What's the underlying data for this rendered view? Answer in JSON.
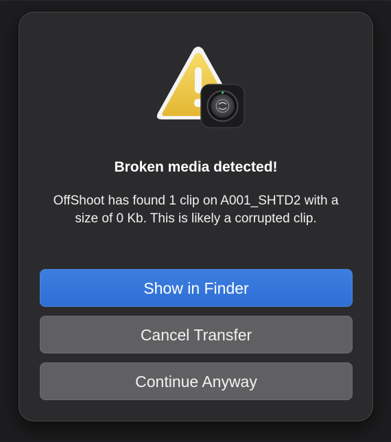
{
  "dialog": {
    "title": "Broken media detected!",
    "message": "OffShoot has found 1 clip on A001_SHTD2 with a size of 0 Kb. This is likely a corrupted clip.",
    "icon": "warning-triangle-with-app-badge-icon",
    "buttons": {
      "show_in_finder": "Show in Finder",
      "cancel_transfer": "Cancel Transfer",
      "continue_anyway": "Continue Anyway"
    }
  },
  "colors": {
    "dialog_background": "#2b2b2d",
    "primary_button": "#3275db",
    "secondary_button": "#606062",
    "warning_yellow": "#f2c94c"
  }
}
